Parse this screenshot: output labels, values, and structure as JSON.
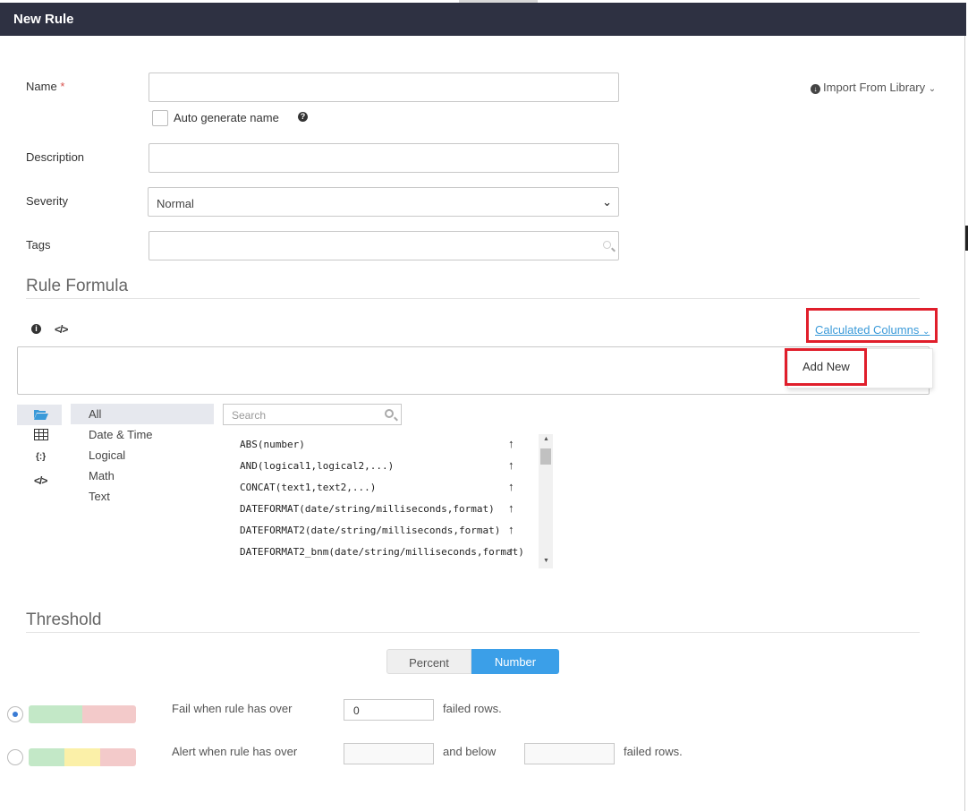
{
  "dialog": {
    "title": "New Rule"
  },
  "form": {
    "name_label": "Name",
    "name_required_mark": "*",
    "name_value": "",
    "auto_generate_label": "Auto generate name",
    "description_label": "Description",
    "description_value": "",
    "severity_label": "Severity",
    "severity_value": "Normal",
    "tags_label": "Tags",
    "tags_value": "",
    "import_label": "Import From Library"
  },
  "formula": {
    "section_title": "Rule Formula",
    "calculated_columns_label": "Calculated Columns",
    "menu": {
      "add_new_label": "Add New"
    },
    "categories": [
      "All",
      "Date & Time",
      "Logical",
      "Math",
      "Text"
    ],
    "selected_category": "All",
    "search_placeholder": "Search",
    "functions": [
      "ABS(number)",
      "AND(logical1,logical2,...)",
      "CONCAT(text1,text2,...)",
      "DATEFORMAT(date/string/milliseconds,format)",
      "DATEFORMAT2(date/string/milliseconds,format)",
      "DATEFORMAT2_bnm(date/string/milliseconds,format)"
    ]
  },
  "threshold": {
    "section_title": "Threshold",
    "toggle_percent": "Percent",
    "toggle_number": "Number",
    "selected_mode": "Number",
    "fail_label": "Fail when rule has over",
    "fail_value": "0",
    "fail_suffix": "failed rows.",
    "alert_label": "Alert when rule has over",
    "alert_value": "",
    "alert_middle": "and below",
    "alert_value2": "",
    "alert_suffix": "failed rows.",
    "selected_option": "fail",
    "colors": {
      "green": "#c3e8c7",
      "yellow": "#fbf0a8",
      "red": "#f3caca"
    }
  },
  "colors": {
    "titlebar": "#2e3142",
    "accent": "#3b9fe8",
    "highlight": "#e01e2b"
  }
}
